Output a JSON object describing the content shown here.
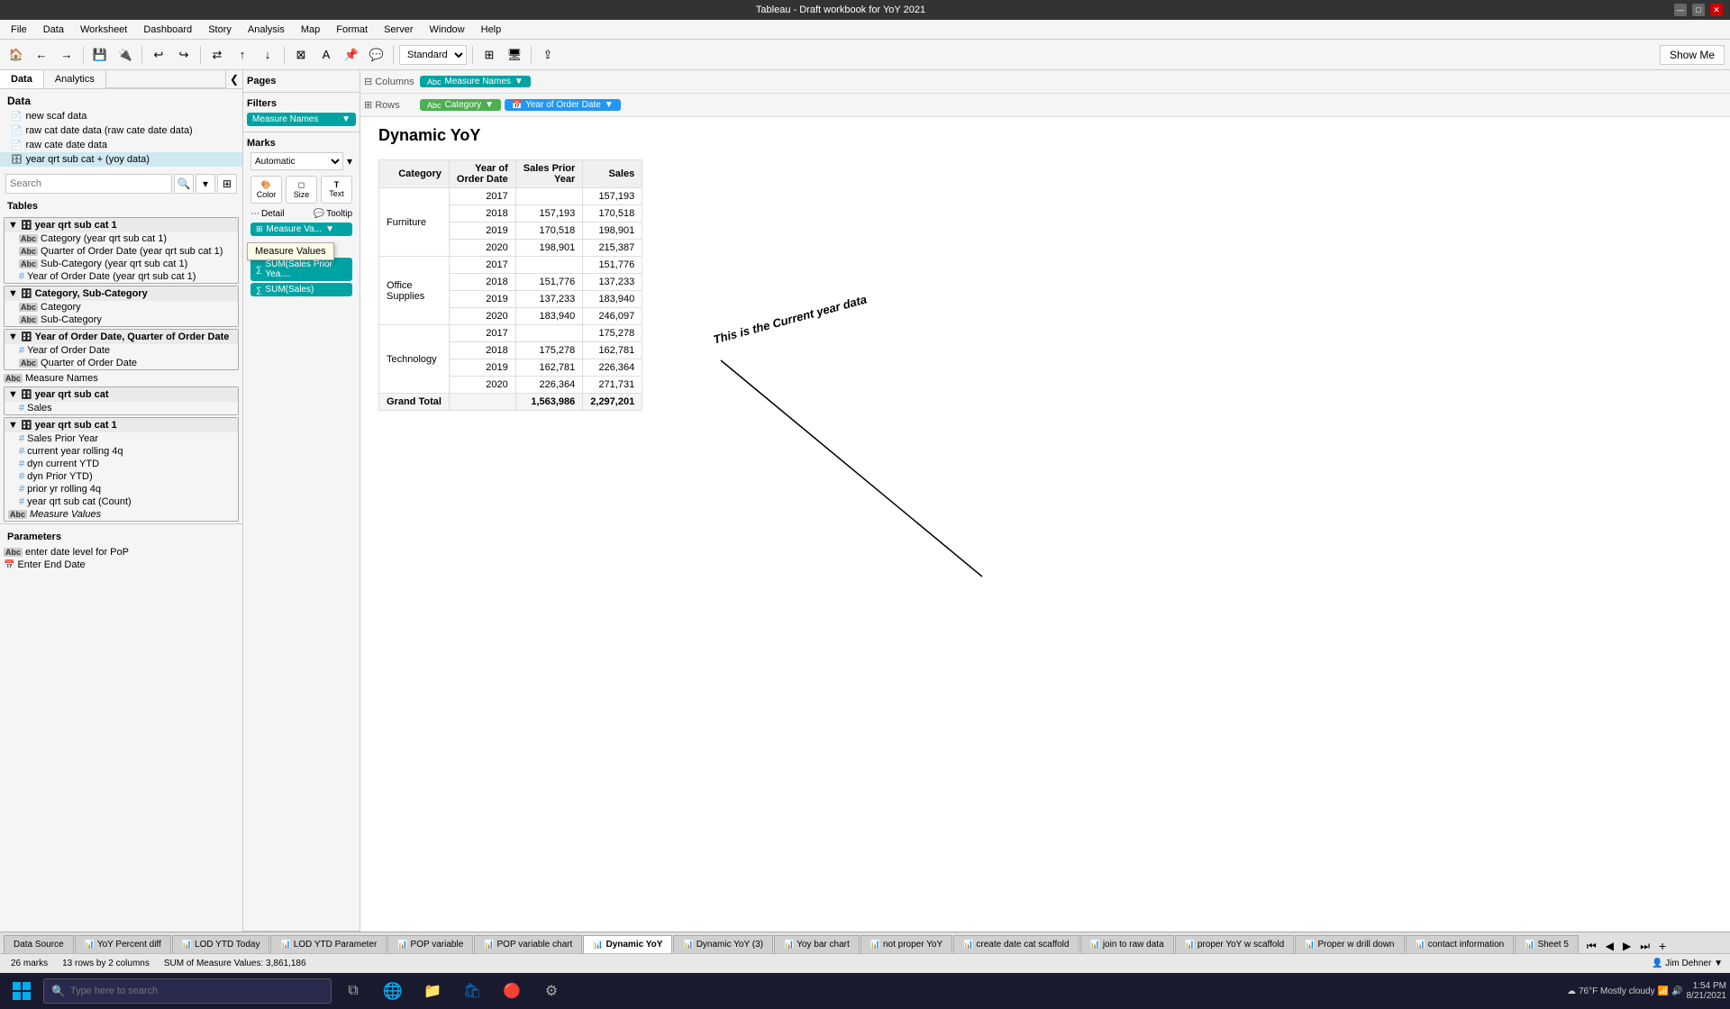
{
  "title_bar": {
    "title": "Tableau - Draft workbook for YoY 2021",
    "min": "—",
    "max": "□",
    "close": "✕"
  },
  "menu": {
    "items": [
      "File",
      "Data",
      "Worksheet",
      "Dashboard",
      "Story",
      "Analysis",
      "Map",
      "Format",
      "Server",
      "Window",
      "Help"
    ]
  },
  "toolbar": {
    "show_me": "Show Me",
    "standard": "Standard"
  },
  "left_panel": {
    "tabs": [
      "Data",
      "Analytics"
    ],
    "active_tab": "Data",
    "data_sources": [
      {
        "label": "new scaf data",
        "icon": "doc"
      },
      {
        "label": "raw cat date data (raw cate date data)",
        "icon": "doc"
      },
      {
        "label": "raw cate date data",
        "icon": "doc"
      },
      {
        "label": "year qrt sub cat + (yoy data)",
        "icon": "db",
        "active": true
      }
    ],
    "search_placeholder": "Search",
    "tables_label": "Tables",
    "tables": [
      {
        "label": "year qrt sub cat 1",
        "type": "group",
        "level": 0,
        "expanded": true,
        "bold": true
      },
      {
        "label": "Category (year qrt sub cat 1)",
        "type": "abc",
        "level": 1
      },
      {
        "label": "Quarter of Order Date (year qrt sub cat 1)",
        "type": "abc",
        "level": 1
      },
      {
        "label": "Sub-Category (year qrt sub cat 1)",
        "type": "abc",
        "level": 1
      },
      {
        "label": "Year of Order Date (year qrt sub cat 1)",
        "type": "hash",
        "level": 1
      },
      {
        "label": "Category, Sub-Category",
        "type": "group",
        "level": 0,
        "expanded": true,
        "bold": true
      },
      {
        "label": "Category",
        "type": "abc",
        "level": 1
      },
      {
        "label": "Sub-Category",
        "type": "abc",
        "level": 1
      },
      {
        "label": "Year of Order Date, Quarter of Order Date",
        "type": "group",
        "level": 0,
        "expanded": true,
        "bold": true
      },
      {
        "label": "Year of Order Date",
        "type": "hash",
        "level": 1
      },
      {
        "label": "Quarter of Order Date",
        "type": "abc",
        "level": 1
      },
      {
        "label": "Measure Names",
        "type": "abc",
        "level": 0
      },
      {
        "label": "year qrt sub cat",
        "type": "group",
        "level": 0,
        "expanded": true,
        "bold": true
      },
      {
        "label": "Sales",
        "type": "hash",
        "level": 1
      },
      {
        "label": "year qrt sub cat 1",
        "type": "group",
        "level": 0,
        "expanded": true,
        "bold": true
      },
      {
        "label": "Sales Prior Year",
        "type": "hash",
        "level": 1
      },
      {
        "label": "current year rolling 4q",
        "type": "hash",
        "level": 1
      },
      {
        "label": "dyn current YTD",
        "type": "hash",
        "level": 1
      },
      {
        "label": "dyn Prior YTD)",
        "type": "hash",
        "level": 1
      },
      {
        "label": "prior yr rolling 4q",
        "type": "hash",
        "level": 1
      },
      {
        "label": "year qrt sub cat  (Count)",
        "type": "hash",
        "level": 1
      },
      {
        "label": "Measure Values",
        "type": "abc-italic",
        "level": 0
      }
    ],
    "parameters_label": "Parameters",
    "parameters": [
      {
        "label": "enter date level for PoP",
        "type": "abc"
      },
      {
        "label": "Enter End Date",
        "type": "cal"
      }
    ]
  },
  "pages_panel": {
    "label": "Pages"
  },
  "filters_panel": {
    "label": "Filters",
    "chips": [
      "Measure Names"
    ]
  },
  "marks_panel": {
    "label": "Marks",
    "type": "Automatic",
    "buttons": [
      {
        "label": "Color",
        "icon": "🎨"
      },
      {
        "label": "Size",
        "icon": "◻"
      },
      {
        "label": "Text",
        "icon": "T"
      }
    ],
    "detail_rows": [
      {
        "label": "Detail",
        "icon": "⋯"
      },
      {
        "label": "Tooltip",
        "icon": "💬"
      }
    ],
    "measure_chip": "Measure Va...",
    "measure_tooltip": "Measure Values",
    "measure_values_label": "Measure Values",
    "mv_chips": [
      "SUM(Sales Prior Yea....",
      "SUM(Sales)"
    ]
  },
  "columns_shelf": {
    "label": "Columns",
    "pills": [
      "Measure Names"
    ]
  },
  "rows_shelf": {
    "label": "Rows",
    "pills": [
      "Category",
      "Year of Order Date"
    ]
  },
  "viz": {
    "title": "Dynamic YoY",
    "table": {
      "headers": [
        "Category",
        "Year of\nOrder Date",
        "Sales Prior\nYear",
        "Sales"
      ],
      "rows": [
        {
          "category": "Furniture",
          "year": "2017",
          "prior": "",
          "sales": "157,193"
        },
        {
          "category": "",
          "year": "2018",
          "prior": "157,193",
          "sales": "170,518"
        },
        {
          "category": "",
          "year": "2019",
          "prior": "170,518",
          "sales": "198,901"
        },
        {
          "category": "",
          "year": "2020",
          "prior": "198,901",
          "sales": "215,387"
        },
        {
          "category": "Office\nSupplies",
          "year": "2017",
          "prior": "",
          "sales": "151,776"
        },
        {
          "category": "",
          "year": "2018",
          "prior": "151,776",
          "sales": "137,233"
        },
        {
          "category": "",
          "year": "2019",
          "prior": "137,233",
          "sales": "183,940"
        },
        {
          "category": "",
          "year": "2020",
          "prior": "183,940",
          "sales": "246,097"
        },
        {
          "category": "Technology",
          "year": "2017",
          "prior": "",
          "sales": "175,278"
        },
        {
          "category": "",
          "year": "2018",
          "prior": "175,278",
          "sales": "162,781"
        },
        {
          "category": "",
          "year": "2019",
          "prior": "162,781",
          "sales": "226,364"
        },
        {
          "category": "",
          "year": "2020",
          "prior": "226,364",
          "sales": "271,731"
        },
        {
          "category": "Grand Total",
          "year": "",
          "prior": "1,563,986",
          "sales": "2,297,201",
          "total": true
        }
      ]
    },
    "annotation": "This is the Current year data"
  },
  "sheet_tabs": [
    {
      "label": "Data Source",
      "icon": ""
    },
    {
      "label": "YoY Percent diff",
      "icon": "📊"
    },
    {
      "label": "LOD YTD Today",
      "icon": "📊"
    },
    {
      "label": "LOD YTD Parameter",
      "icon": "📊"
    },
    {
      "label": "POP variable",
      "icon": "📊"
    },
    {
      "label": "POP variable chart",
      "icon": "📊"
    },
    {
      "label": "Dynamic YoY",
      "icon": "📊",
      "active": true
    },
    {
      "label": "Dynamic YoY (3)",
      "icon": "📊"
    },
    {
      "label": "Yoy bar chart",
      "icon": "📊"
    },
    {
      "label": "not proper YoY",
      "icon": "📊"
    },
    {
      "label": "create date cat scaffold",
      "icon": "📊"
    },
    {
      "label": "join to raw data",
      "icon": "📊"
    },
    {
      "label": "proper YoY w scaffold",
      "icon": "📊"
    },
    {
      "label": "Proper w drill down",
      "icon": "📊"
    },
    {
      "label": "contact information",
      "icon": "📊"
    },
    {
      "label": "Sheet 5",
      "icon": "📊"
    }
  ],
  "status_bar": {
    "marks": "26 marks",
    "rows": "13 rows by 2 columns",
    "sum": "SUM of Measure Values: 3,861,186"
  },
  "taskbar": {
    "search_placeholder": "Type here to search",
    "weather": "76°F  Mostly cloudy",
    "time": "1:54 PM",
    "date": "8/21/2021",
    "user": "Jim Dehner"
  }
}
